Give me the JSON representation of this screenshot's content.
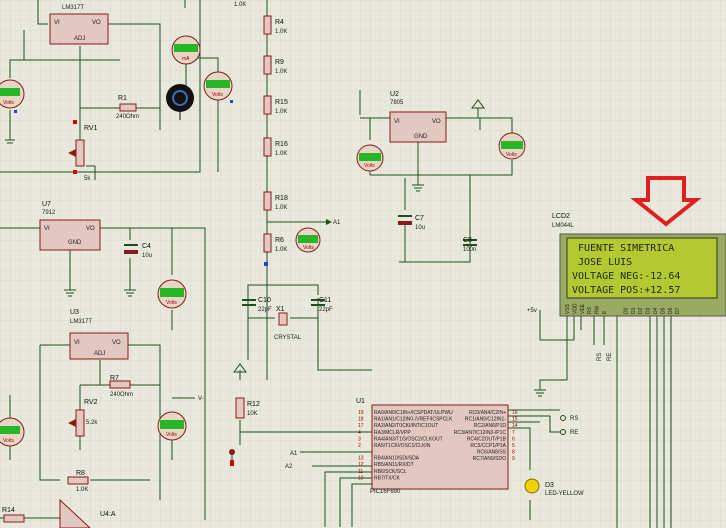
{
  "components": {
    "lm317t_top": {
      "ref": "",
      "part": "LM317T",
      "vi": "VI",
      "vo": "VO",
      "adj": "ADJ"
    },
    "r1": {
      "ref": "R1",
      "value": "240Ohm"
    },
    "rv1": {
      "ref": "RV1",
      "value": "5k"
    },
    "r4": {
      "ref": "R4",
      "value": "1.0K"
    },
    "r9": {
      "ref": "R9",
      "value": "1.0K"
    },
    "r15": {
      "ref": "R15",
      "value": "1.0K"
    },
    "r16": {
      "ref": "R16",
      "value": "1.0K"
    },
    "r18": {
      "ref": "R18",
      "value": "1.0K"
    },
    "r6": {
      "ref": "R6",
      "value": "1.0K"
    },
    "r_top": {
      "value": "1.0K"
    },
    "u7": {
      "ref": "U7",
      "part": "7912",
      "vi": "VI",
      "vo": "VO",
      "gnd": "GND"
    },
    "c4": {
      "ref": "C4",
      "value": "10u"
    },
    "u3": {
      "ref": "U3",
      "part": "LM317T",
      "vi": "VI",
      "vo": "VO",
      "adj": "ADJ"
    },
    "r7": {
      "ref": "R7",
      "value": "240Ohm"
    },
    "rv2": {
      "ref": "RV2",
      "value": "5.2k"
    },
    "r8": {
      "ref": "R8",
      "value": "1.0K"
    },
    "r14": {
      "ref": "R14",
      "value": "1.0K"
    },
    "u4a": {
      "ref": "U4:A"
    },
    "u2": {
      "ref": "U2",
      "part": "7805",
      "vi": "VI",
      "vo": "VO",
      "gnd": "GND"
    },
    "c7": {
      "ref": "C7",
      "value": "10u"
    },
    "c8": {
      "ref": "C8",
      "value": "100n"
    },
    "c10": {
      "ref": "C10",
      "value": "22pF"
    },
    "c11": {
      "ref": "C11",
      "value": "22pF"
    },
    "x1": {
      "ref": "X1",
      "value": "CRYSTAL"
    },
    "r12": {
      "ref": "R12",
      "value": "10K"
    },
    "u1": {
      "ref": "U1",
      "part": "PIC16F690"
    },
    "d3": {
      "ref": "D3",
      "value": "LED-YELLOW"
    },
    "lcd2": {
      "ref": "LCD2",
      "part": "LM044L"
    }
  },
  "u1_pins_left": [
    "RA0/AN0/C1IN+/ICSPDAT/ULPWU",
    "RA1/AN1/C12IN0-/VREF/ICSPCLK",
    "RA2/AN2/T0CKI/INT/C1OUT",
    "RA3/MCLR/VPP",
    "RA4/AN3/T1G/OSC2/CLKOUT",
    "RA5/T1CKI/OSC1/CLKIN",
    "RB4/AN10/SDI/SDA",
    "RB5/AN11/RX/DT",
    "RB6/SCK/SCL",
    "RB7/TX/CK"
  ],
  "u1_pins_right": [
    "RC0/AN4/C2IN+",
    "RC1/AN5/C12IN1-",
    "RC2/AN6/P1D",
    "RC3/AN7/C12IN3-/P1C",
    "RC4/C2OUT/P1B",
    "RC5/CCP1/P1A",
    "RC6/AN8/SS",
    "RC7/AN9/SDO"
  ],
  "u1_pin_nums_left": [
    "19",
    "18",
    "17",
    "4",
    "3",
    "2",
    "13",
    "12",
    "11",
    "10"
  ],
  "u1_pin_nums_right": [
    "16",
    "15",
    "14",
    "7",
    "6",
    "5",
    "8",
    "9"
  ],
  "labels": {
    "rs": "RS",
    "re": "RE",
    "a1": "A1",
    "a2": "A2",
    "vminus": "V-",
    "plus5": "+5v",
    "rs_lcd": "RS",
    "re_lcd": "RE"
  },
  "lcd_pins": [
    "VSS",
    "VDD",
    "VEE",
    "RS",
    "RW",
    "E",
    "D0",
    "D1",
    "D2",
    "D3",
    "D4",
    "D5",
    "D6",
    "D7"
  ],
  "lcd_lines": [
    "FUENTE SIMETRICA",
    "   JOSE LUIS",
    "VOLTAGE NEG:-12.64",
    "VOLTAGE POS:+12.57"
  ],
  "voltmeters": {
    "vm_left_top": {
      "reading": "+0.00",
      "unit": "Volts"
    },
    "vm_mid": {
      "reading": "+0.00",
      "unit": "Volts"
    },
    "vm_ma": {
      "reading": "0.00",
      "unit": "mA"
    },
    "vm_r6": {
      "reading": "+0.00",
      "unit": "Volts"
    },
    "vm_u7": {
      "reading": "+0.00",
      "unit": "Volts"
    },
    "vm_left_bot": {
      "reading": "+0.00",
      "unit": "Volts"
    },
    "vm_u3": {
      "reading": "+0.00",
      "unit": "Volts"
    },
    "vm_u2_in": {
      "reading": "+0.00",
      "unit": "Volts"
    },
    "vm_u2_out": {
      "reading": "+0.00",
      "unit": "Volts"
    }
  },
  "colors": {
    "canvas": "#e8e8dc",
    "grid": "#cfcfbf",
    "wire": "#1f4f1f",
    "body": "#e2c8c0",
    "body_border": "#8b1a1a",
    "lcd_bg": "#b4c832",
    "lcd_frame": "#9aaa60",
    "arrow": "#e02020",
    "meter_screen": "#26b626",
    "led": "#f0d000"
  }
}
